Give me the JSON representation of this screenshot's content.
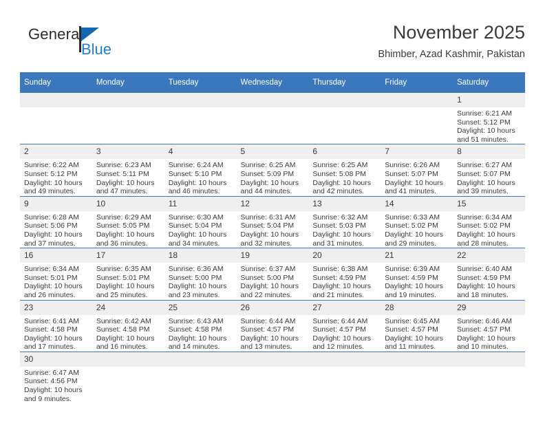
{
  "logo": {
    "text_primary": "General",
    "text_secondary": "Blue",
    "flag_color": "#1268b3",
    "secondary_color": "#1f7fd0"
  },
  "header": {
    "title": "November 2025",
    "subtitle": "Bhimber, Azad Kashmir, Pakistan",
    "accent_color": "#3b77bd"
  },
  "weekday_headers": [
    "Sunday",
    "Monday",
    "Tuesday",
    "Wednesday",
    "Thursday",
    "Friday",
    "Saturday"
  ],
  "labels": {
    "sunrise": "Sunrise:",
    "sunset": "Sunset:",
    "daylight": "Daylight:"
  },
  "weeks": [
    [
      {
        "day": "",
        "empty": true
      },
      {
        "day": "",
        "empty": true
      },
      {
        "day": "",
        "empty": true
      },
      {
        "day": "",
        "empty": true
      },
      {
        "day": "",
        "empty": true
      },
      {
        "day": "",
        "empty": true
      },
      {
        "day": "1",
        "sunrise": "Sunrise: 6:21 AM",
        "sunset": "Sunset: 5:12 PM",
        "daylight": "Daylight: 10 hours and 51 minutes."
      }
    ],
    [
      {
        "day": "2",
        "sunrise": "Sunrise: 6:22 AM",
        "sunset": "Sunset: 5:12 PM",
        "daylight": "Daylight: 10 hours and 49 minutes."
      },
      {
        "day": "3",
        "sunrise": "Sunrise: 6:23 AM",
        "sunset": "Sunset: 5:11 PM",
        "daylight": "Daylight: 10 hours and 47 minutes."
      },
      {
        "day": "4",
        "sunrise": "Sunrise: 6:24 AM",
        "sunset": "Sunset: 5:10 PM",
        "daylight": "Daylight: 10 hours and 46 minutes."
      },
      {
        "day": "5",
        "sunrise": "Sunrise: 6:25 AM",
        "sunset": "Sunset: 5:09 PM",
        "daylight": "Daylight: 10 hours and 44 minutes."
      },
      {
        "day": "6",
        "sunrise": "Sunrise: 6:25 AM",
        "sunset": "Sunset: 5:08 PM",
        "daylight": "Daylight: 10 hours and 42 minutes."
      },
      {
        "day": "7",
        "sunrise": "Sunrise: 6:26 AM",
        "sunset": "Sunset: 5:07 PM",
        "daylight": "Daylight: 10 hours and 41 minutes."
      },
      {
        "day": "8",
        "sunrise": "Sunrise: 6:27 AM",
        "sunset": "Sunset: 5:07 PM",
        "daylight": "Daylight: 10 hours and 39 minutes."
      }
    ],
    [
      {
        "day": "9",
        "sunrise": "Sunrise: 6:28 AM",
        "sunset": "Sunset: 5:06 PM",
        "daylight": "Daylight: 10 hours and 37 minutes."
      },
      {
        "day": "10",
        "sunrise": "Sunrise: 6:29 AM",
        "sunset": "Sunset: 5:05 PM",
        "daylight": "Daylight: 10 hours and 36 minutes."
      },
      {
        "day": "11",
        "sunrise": "Sunrise: 6:30 AM",
        "sunset": "Sunset: 5:04 PM",
        "daylight": "Daylight: 10 hours and 34 minutes."
      },
      {
        "day": "12",
        "sunrise": "Sunrise: 6:31 AM",
        "sunset": "Sunset: 5:04 PM",
        "daylight": "Daylight: 10 hours and 32 minutes."
      },
      {
        "day": "13",
        "sunrise": "Sunrise: 6:32 AM",
        "sunset": "Sunset: 5:03 PM",
        "daylight": "Daylight: 10 hours and 31 minutes."
      },
      {
        "day": "14",
        "sunrise": "Sunrise: 6:33 AM",
        "sunset": "Sunset: 5:02 PM",
        "daylight": "Daylight: 10 hours and 29 minutes."
      },
      {
        "day": "15",
        "sunrise": "Sunrise: 6:34 AM",
        "sunset": "Sunset: 5:02 PM",
        "daylight": "Daylight: 10 hours and 28 minutes."
      }
    ],
    [
      {
        "day": "16",
        "sunrise": "Sunrise: 6:34 AM",
        "sunset": "Sunset: 5:01 PM",
        "daylight": "Daylight: 10 hours and 26 minutes."
      },
      {
        "day": "17",
        "sunrise": "Sunrise: 6:35 AM",
        "sunset": "Sunset: 5:01 PM",
        "daylight": "Daylight: 10 hours and 25 minutes."
      },
      {
        "day": "18",
        "sunrise": "Sunrise: 6:36 AM",
        "sunset": "Sunset: 5:00 PM",
        "daylight": "Daylight: 10 hours and 23 minutes."
      },
      {
        "day": "19",
        "sunrise": "Sunrise: 6:37 AM",
        "sunset": "Sunset: 5:00 PM",
        "daylight": "Daylight: 10 hours and 22 minutes."
      },
      {
        "day": "20",
        "sunrise": "Sunrise: 6:38 AM",
        "sunset": "Sunset: 4:59 PM",
        "daylight": "Daylight: 10 hours and 21 minutes."
      },
      {
        "day": "21",
        "sunrise": "Sunrise: 6:39 AM",
        "sunset": "Sunset: 4:59 PM",
        "daylight": "Daylight: 10 hours and 19 minutes."
      },
      {
        "day": "22",
        "sunrise": "Sunrise: 6:40 AM",
        "sunset": "Sunset: 4:59 PM",
        "daylight": "Daylight: 10 hours and 18 minutes."
      }
    ],
    [
      {
        "day": "23",
        "sunrise": "Sunrise: 6:41 AM",
        "sunset": "Sunset: 4:58 PM",
        "daylight": "Daylight: 10 hours and 17 minutes."
      },
      {
        "day": "24",
        "sunrise": "Sunrise: 6:42 AM",
        "sunset": "Sunset: 4:58 PM",
        "daylight": "Daylight: 10 hours and 16 minutes."
      },
      {
        "day": "25",
        "sunrise": "Sunrise: 6:43 AM",
        "sunset": "Sunset: 4:58 PM",
        "daylight": "Daylight: 10 hours and 14 minutes."
      },
      {
        "day": "26",
        "sunrise": "Sunrise: 6:44 AM",
        "sunset": "Sunset: 4:57 PM",
        "daylight": "Daylight: 10 hours and 13 minutes."
      },
      {
        "day": "27",
        "sunrise": "Sunrise: 6:44 AM",
        "sunset": "Sunset: 4:57 PM",
        "daylight": "Daylight: 10 hours and 12 minutes."
      },
      {
        "day": "28",
        "sunrise": "Sunrise: 6:45 AM",
        "sunset": "Sunset: 4:57 PM",
        "daylight": "Daylight: 10 hours and 11 minutes."
      },
      {
        "day": "29",
        "sunrise": "Sunrise: 6:46 AM",
        "sunset": "Sunset: 4:57 PM",
        "daylight": "Daylight: 10 hours and 10 minutes."
      }
    ],
    [
      {
        "day": "30",
        "sunrise": "Sunrise: 6:47 AM",
        "sunset": "Sunset: 4:56 PM",
        "daylight": "Daylight: 10 hours and 9 minutes."
      },
      {
        "day": "",
        "empty": true
      },
      {
        "day": "",
        "empty": true
      },
      {
        "day": "",
        "empty": true
      },
      {
        "day": "",
        "empty": true
      },
      {
        "day": "",
        "empty": true
      },
      {
        "day": "",
        "empty": true
      }
    ]
  ]
}
